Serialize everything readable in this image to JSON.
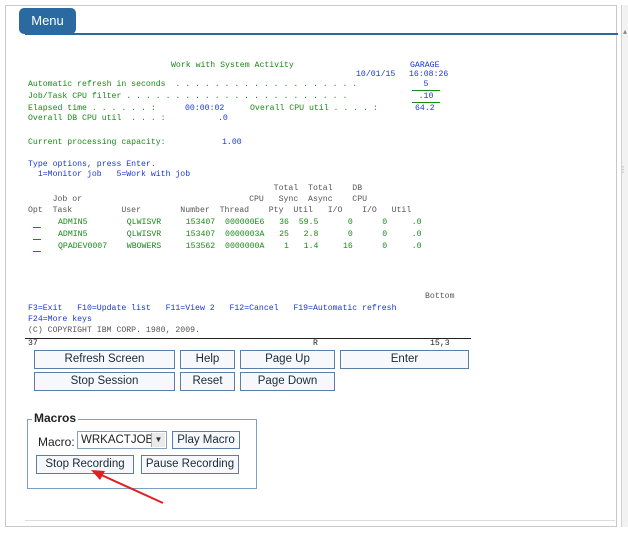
{
  "menu": {
    "label": "Menu"
  },
  "terminal": {
    "header_title": "Work with System Activity",
    "system_name": "GARAGE",
    "date": "10/01/15",
    "time": "16:08:26",
    "refresh_label": "Automatic refresh in seconds  . . . . . . . . . . . . . . . . . . .",
    "refresh_value": "5",
    "filter_label": "Job/Task CPU filter . . . . . . . . . . . . . . . . . . . . . . .",
    "filter_value": ".10",
    "elapsed_label": "Elapsed time . . . . . . :",
    "elapsed_value": "00:00:02",
    "overall_cpu_label": "Overall CPU util . . . . :",
    "overall_cpu_value": "64.2",
    "overall_db_label": "Overall DB CPU util  . . . :",
    "overall_db_value": ".0",
    "capacity_label": "Current processing capacity:",
    "capacity_value": "1.00",
    "type_options": "Type options, press Enter.",
    "options_line": "  1=Monitor job   5=Work with job",
    "col_hdr_1": "                                                  Total  Total    DB",
    "col_hdr_2": "     Job or                                  CPU   Sync  Async    CPU",
    "col_hdr_3": "Opt  Task          User        Number  Thread    Pty  Util   I/O    I/O   Util",
    "rows": [
      "ADMIN5        QLWISVR     153407  000000E6   36  59.5      0      0     .0",
      "ADMIN5        QLWISVR     153407  0000003A   25   2.8      0      0     .0",
      "QPADEV0007    WBOWERS     153562  0000000A    1   1.4     16      0     .0"
    ],
    "bottom_label": "Bottom",
    "fkeys_1": "F3=Exit   F10=Update list   F11=View 2   F12=Cancel   F19=Automatic refresh",
    "fkeys_2": "F24=More keys",
    "copyright": "(C) COPYRIGHT IBM CORP. 1980, 2009.",
    "status_left": "37",
    "status_mid": "R",
    "status_right": "15,3"
  },
  "buttons": {
    "refresh_screen": "Refresh Screen",
    "help": "Help",
    "page_up": "Page Up",
    "enter": "Enter",
    "stop_session": "Stop Session",
    "reset": "Reset",
    "page_down": "Page Down"
  },
  "macros": {
    "legend": "Macros",
    "macro_label": "Macro:",
    "selected_macro": "WRKACTJOB",
    "play_macro": "Play Macro",
    "stop_recording": "Stop Recording",
    "pause_recording": "Pause Recording"
  },
  "colors": {
    "accent": "#2a6aa1",
    "terminal_blue": "#1a37d6",
    "terminal_green": "#168a16",
    "arrow": "#e02020"
  }
}
